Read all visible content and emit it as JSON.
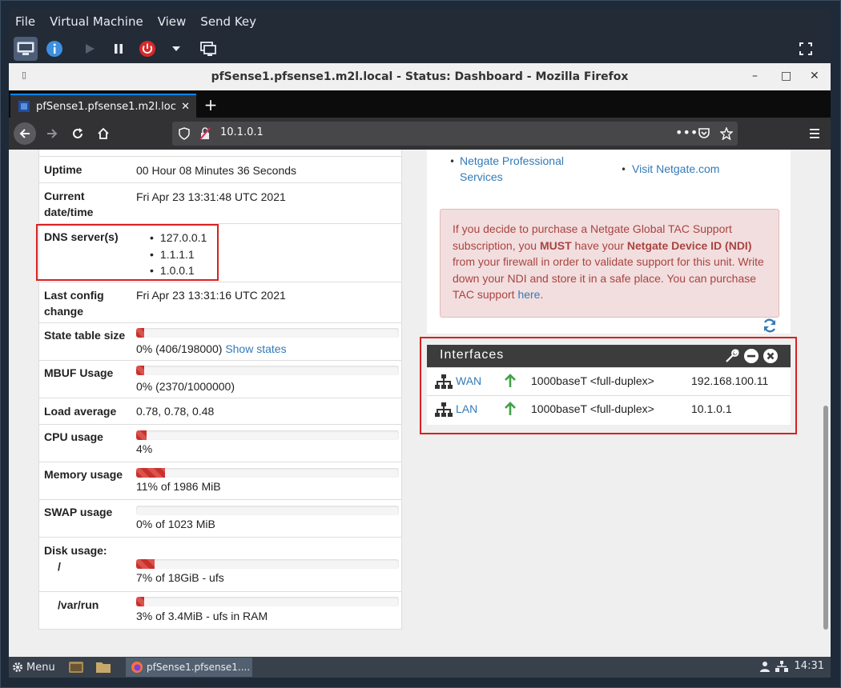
{
  "vm": {
    "menu": [
      "File",
      "Virtual Machine",
      "View",
      "Send Key"
    ]
  },
  "firefox": {
    "window_title": "pfSense1.pfsense1.m2l.local - Status: Dashboard - Mozilla Firefox",
    "tab_label": "pfSense1.pfsense1.m2l.loc",
    "url": "10.1.0.1",
    "controls": {
      "minimize": "–",
      "maximize": "□",
      "close": "✕"
    }
  },
  "system_info": {
    "uptime": {
      "label": "Uptime",
      "value": "00 Hour 08 Minutes 36 Seconds"
    },
    "datetime": {
      "label_line1": "Current",
      "label_line2": "date/time",
      "value": "Fri Apr 23 13:31:48 UTC 2021"
    },
    "dns": {
      "label": "DNS server(s)",
      "servers": [
        "127.0.0.1",
        "1.1.1.1",
        "1.0.0.1"
      ]
    },
    "last_config": {
      "label_line1": "Last config",
      "label_line2": "change",
      "value": "Fri Apr 23 13:31:16 UTC 2021"
    },
    "state_table": {
      "label": "State table size",
      "value": "0% (406/198000)",
      "link": "Show states",
      "fraction": 0.002
    },
    "mbuf": {
      "label": "MBUF Usage",
      "value": "0% (2370/1000000)",
      "fraction": 0.002
    },
    "load": {
      "label": "Load average",
      "value": "0.78, 0.78, 0.48"
    },
    "cpu": {
      "label": "CPU usage",
      "value": "4%",
      "fraction": 0.04
    },
    "memory": {
      "label": "Memory usage",
      "value": "11% of 1986 MiB",
      "fraction": 0.11
    },
    "swap": {
      "label": "SWAP usage",
      "value": "0% of 1023 MiB",
      "fraction": 0.0
    },
    "disk": {
      "label": "Disk usage:",
      "mount1": "/",
      "mount1_value": "7% of 18GiB - ufs",
      "mount1_fraction": 0.07,
      "mount2": "/var/run",
      "mount2_value": "3% of 3.4MiB - ufs in RAM",
      "mount2_fraction": 0.03
    }
  },
  "netgate": {
    "link1_line1": "Netgate Professional",
    "link1_line2": "Services",
    "link2": "Visit Netgate.com",
    "alert": {
      "t1": "If you decide to purchase a Netgate Global TAC Support subscription, you ",
      "b1": "MUST",
      "t2": " have your ",
      "b2": "Netgate Device ID (NDI)",
      "t3": " from your firewall in order to validate support for this unit. Write down your NDI and store it in a safe place. You can purchase TAC support ",
      "link": "here",
      "t4": "."
    }
  },
  "interfaces": {
    "title": "Interfaces",
    "rows": [
      {
        "name": "WAN",
        "media": "1000baseT <full-duplex>",
        "ip": "192.168.100.11"
      },
      {
        "name": "LAN",
        "media": "1000baseT <full-duplex>",
        "ip": "10.1.0.1"
      }
    ]
  },
  "taskbar": {
    "menu": "Menu",
    "task": "pfSense1.pfsense1....",
    "clock": "14:31"
  },
  "colors": {
    "accent_red": "#d92020",
    "link_blue": "#337ab7",
    "progress_red": "#d9534f",
    "up_green": "#43a047"
  }
}
